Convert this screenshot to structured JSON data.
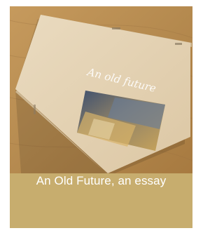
{
  "photo": {
    "cover_title": "An old future",
    "tabletop_color": "#b58a4f",
    "cover_color": "#e6d5b8"
  },
  "caption": {
    "text": "An Old Future, an essay",
    "bar_color": "#c7ad6e",
    "text_color": "#ffffff"
  }
}
